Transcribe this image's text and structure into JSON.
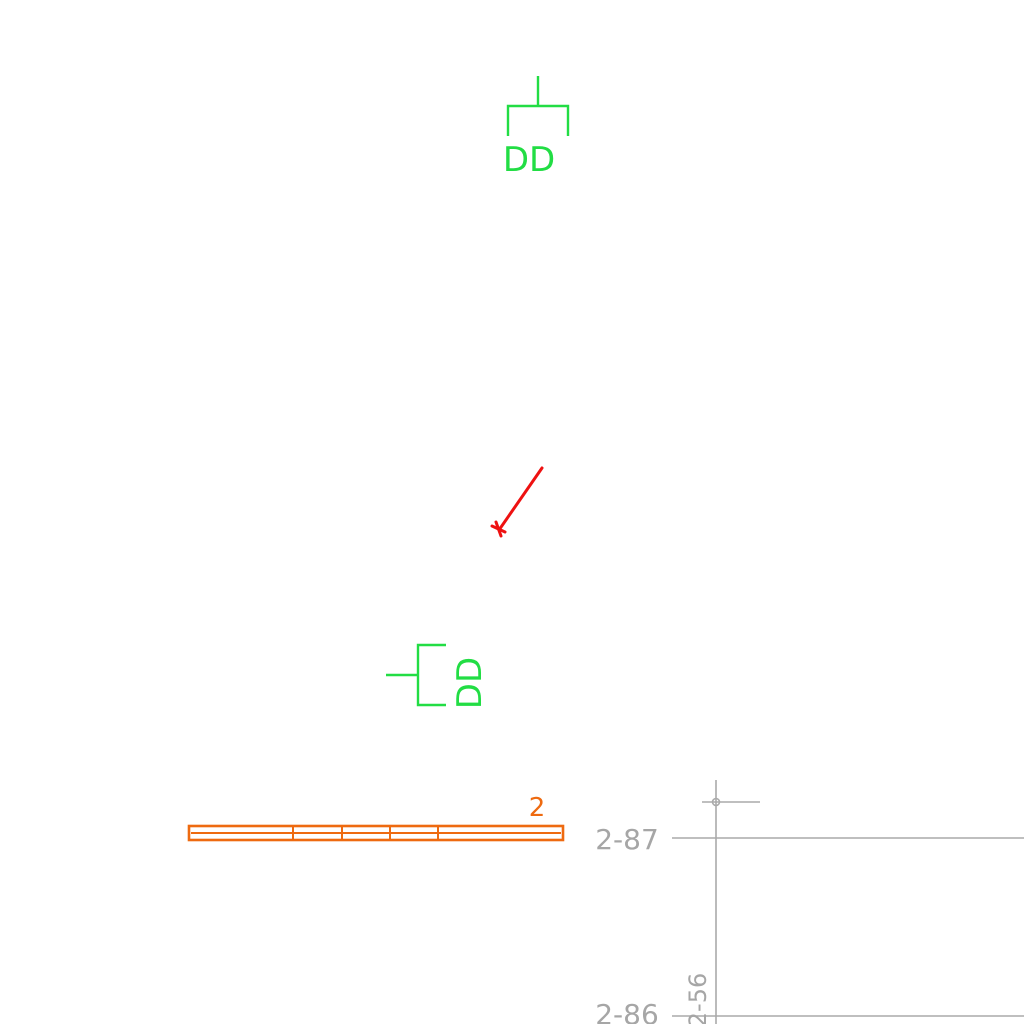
{
  "drawing": {
    "symbols": [
      {
        "name": "section-marker-top",
        "label": "DD"
      },
      {
        "name": "section-marker-bottom",
        "label": "DD"
      }
    ],
    "beam": {
      "label": "2"
    },
    "grid": {
      "labels": {
        "row_a": "2-87",
        "row_b": "2-86",
        "col": "2-56"
      }
    },
    "colors": {
      "marker": "#22dd44",
      "beam": "#ee6a10",
      "arrow": "#ee1111",
      "grid": "#aaaaaa",
      "grid_text": "#a6a6a6"
    }
  }
}
